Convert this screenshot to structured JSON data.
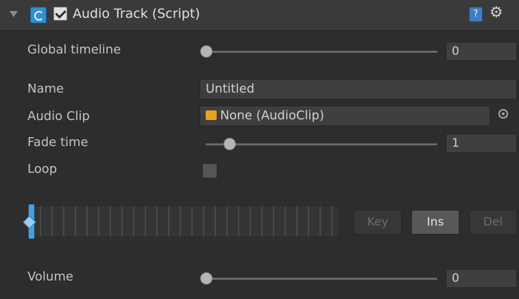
{
  "header": {
    "title": "Audio Track (Script)",
    "enabled": true,
    "help_glyph": "?",
    "gear_glyph": "⚙"
  },
  "fields": {
    "global_timeline": {
      "label": "Global timeline",
      "value": "0",
      "slider_fraction": 0.0
    },
    "name": {
      "label": "Name",
      "value": "Untitled"
    },
    "audio_clip": {
      "label": "Audio Clip",
      "value": "None (AudioClip)"
    },
    "fade_time": {
      "label": "Fade time",
      "value": "1",
      "slider_fraction": 0.1
    },
    "loop": {
      "label": "Loop",
      "checked": false
    },
    "volume": {
      "label": "Volume",
      "value": "0",
      "slider_fraction": 0.0
    }
  },
  "timeline_buttons": {
    "key": "Key",
    "ins": "Ins",
    "del": "Del"
  },
  "icons": {
    "foldout": "foldout-triangle-icon",
    "script": "script-icon",
    "help": "help-book-icon",
    "settings": "gear-icon",
    "audio": "audio-clip-icon",
    "picker": "object-picker-icon"
  },
  "colors": {
    "accent": "#3da0e8",
    "audio_icon": "#e8a321",
    "background": "#2d2d2d"
  }
}
